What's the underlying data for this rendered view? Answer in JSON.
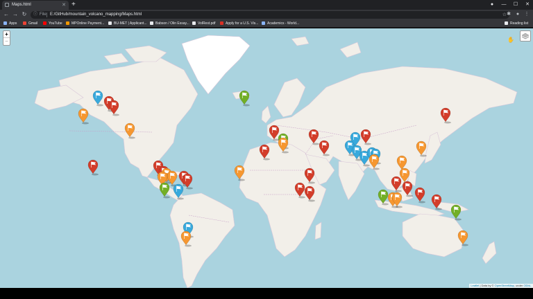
{
  "tab": {
    "title": "Maps.html",
    "close": "✕"
  },
  "new_tab": "+",
  "window": {
    "profile": "●",
    "minimize": "—",
    "maximize": "☐",
    "close": "✕"
  },
  "toolbar": {
    "back": "←",
    "forward": "→",
    "reload": "↻",
    "info": "ⓘ",
    "scheme": "File",
    "url": "E:/GitHub/mountain_volcano_mapping/Maps.html",
    "star": "☆",
    "extensions": "✱",
    "profile": "●",
    "menu": "⋮"
  },
  "bookmarks": [
    {
      "label": "Apps",
      "color": "#8ab4f8"
    },
    {
      "label": "Gmail",
      "color": "#ea4335"
    },
    {
      "label": "YouTube",
      "color": "#ff0000"
    },
    {
      "label": "MPOnline Payment...",
      "color": "#f29900"
    },
    {
      "label": "BU-MET | Applicant...",
      "color": "#e8eaed"
    },
    {
      "label": "Babson / Olin Essay...",
      "color": "#e8eaed"
    },
    {
      "label": "VolRest.pdf",
      "color": "#e8eaed"
    },
    {
      "label": "Apply for a U.S. Vis...",
      "color": "#d93025"
    },
    {
      "label": "Academics - World...",
      "color": "#8ab4f8"
    }
  ],
  "reading_list": "Reading list",
  "map": {
    "zoom_in": "+",
    "zoom_out": "−",
    "attribution": {
      "leaflet": "Leaflet",
      "sep": " | Data by © ",
      "osm": "OpenStreetMap",
      "rest": ", under ",
      "odbl": "ODbL."
    },
    "colors": {
      "ocean": "#aad3df",
      "land": "#f2efe9",
      "ice": "#ffffff",
      "border": "#c8a0c8"
    },
    "marker_colors": {
      "red": "#d33d2a",
      "blue": "#38a9dc",
      "orange": "#f69730",
      "green": "#72af26"
    },
    "marker_icon": "flag-icon",
    "markers": [
      {
        "id": "m1",
        "color": "blue"
      },
      {
        "id": "m2",
        "color": "red"
      },
      {
        "id": "m3",
        "color": "red"
      },
      {
        "id": "m4",
        "color": "orange"
      },
      {
        "id": "m5",
        "color": "orange"
      },
      {
        "id": "m6",
        "color": "red"
      },
      {
        "id": "m7",
        "color": "red"
      },
      {
        "id": "m8",
        "color": "red"
      },
      {
        "id": "m9",
        "color": "orange"
      },
      {
        "id": "m10",
        "color": "orange"
      },
      {
        "id": "m11",
        "color": "orange"
      },
      {
        "id": "m12",
        "color": "red"
      },
      {
        "id": "m13",
        "color": "red"
      },
      {
        "id": "m14",
        "color": "green"
      },
      {
        "id": "m15",
        "color": "blue"
      },
      {
        "id": "m16",
        "color": "blue"
      },
      {
        "id": "m17",
        "color": "orange"
      },
      {
        "id": "m18",
        "color": "orange"
      },
      {
        "id": "m19",
        "color": "green"
      },
      {
        "id": "m20",
        "color": "red"
      },
      {
        "id": "m21",
        "color": "green"
      },
      {
        "id": "m22",
        "color": "orange"
      },
      {
        "id": "m23",
        "color": "red"
      },
      {
        "id": "m24",
        "color": "red"
      },
      {
        "id": "m25",
        "color": "red"
      },
      {
        "id": "m26",
        "color": "red"
      },
      {
        "id": "m27",
        "color": "red"
      },
      {
        "id": "m28",
        "color": "red"
      },
      {
        "id": "m29",
        "color": "blue"
      },
      {
        "id": "m30",
        "color": "blue"
      },
      {
        "id": "m31",
        "color": "blue"
      },
      {
        "id": "m32",
        "color": "blue"
      },
      {
        "id": "m33",
        "color": "red"
      },
      {
        "id": "m34",
        "color": "blue"
      },
      {
        "id": "m35",
        "color": "blue"
      },
      {
        "id": "m36",
        "color": "orange"
      },
      {
        "id": "m37",
        "color": "orange"
      },
      {
        "id": "m38",
        "color": "orange"
      },
      {
        "id": "m39",
        "color": "red"
      },
      {
        "id": "m40",
        "color": "orange"
      },
      {
        "id": "m41",
        "color": "red"
      },
      {
        "id": "m42",
        "color": "green"
      },
      {
        "id": "m43",
        "color": "orange"
      },
      {
        "id": "m44",
        "color": "orange"
      },
      {
        "id": "m45",
        "color": "red"
      },
      {
        "id": "m46",
        "color": "red"
      },
      {
        "id": "m47",
        "color": "red"
      },
      {
        "id": "m48",
        "color": "green"
      },
      {
        "id": "m49",
        "color": "orange"
      }
    ]
  }
}
